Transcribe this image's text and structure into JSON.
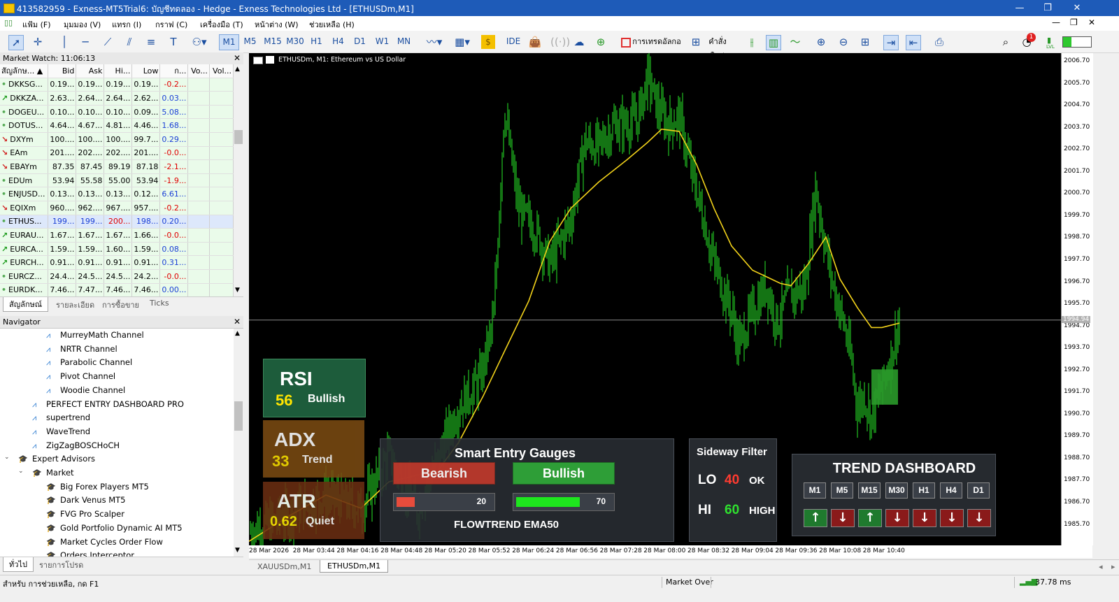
{
  "window": {
    "title": "413582959 - Exness-MT5Trial6: บัญชีทดลอง - Hedge - Exness Technologies Ltd - [ETHUSDm,M1]",
    "controls": [
      "—",
      "❐",
      "✕"
    ]
  },
  "menu": [
    "แฟ้ม (F)",
    "มุมมอง (V)",
    "แทรก (I)",
    "กราฟ (C)",
    "เครื่องมือ (T)",
    "หน้าต่าง (W)",
    "ช่วยเหลือ (H)"
  ],
  "toolbar": {
    "timeframes": [
      "M1",
      "M5",
      "M15",
      "M30",
      "H1",
      "H4",
      "D1",
      "W1",
      "MN"
    ],
    "active_timeframe": "M1",
    "ide_label": "IDE",
    "algo_label": "การเทรดอัลกอ",
    "new_order_label": "คำสั่งใหม่",
    "notification_count": "1",
    "signal_label": "LVL"
  },
  "market_watch": {
    "title": "Market Watch: 11:06:13",
    "columns": [
      "สัญลักษ...",
      "Bid",
      "Ask",
      "Hi...",
      "Low",
      "ก...",
      "Vo...",
      "Vol..."
    ],
    "rows": [
      {
        "sym": "DKKSG...",
        "arrow": "•",
        "bid": "0.19...",
        "ask": "0.19...",
        "hi": "0.19...",
        "low": "0.19...",
        "chg": "-0.2...",
        "chgcolor": "#e00000"
      },
      {
        "sym": "DKKZA...",
        "arrow": "↗",
        "bid": "2.63...",
        "ask": "2.64...",
        "hi": "2.64...",
        "low": "2.62...",
        "chg": "0.03...",
        "chgcolor": "#1a3fd6"
      },
      {
        "sym": "DOGEU...",
        "arrow": "•",
        "bid": "0.10...",
        "ask": "0.10...",
        "hi": "0.10...",
        "low": "0.09...",
        "chg": "5.08...",
        "chgcolor": "#1a3fd6"
      },
      {
        "sym": "DOTUS...",
        "arrow": "•",
        "bid": "4.64...",
        "ask": "4.67...",
        "hi": "4.81...",
        "low": "4.46...",
        "chg": "1.68...",
        "chgcolor": "#1a3fd6"
      },
      {
        "sym": "DXYm",
        "arrow": "↘",
        "bid": "100....",
        "ask": "100....",
        "hi": "100....",
        "low": "99.7...",
        "chg": "0.29...",
        "chgcolor": "#1a3fd6"
      },
      {
        "sym": "EAm",
        "arrow": "↘",
        "bid": "201....",
        "ask": "202....",
        "hi": "202....",
        "low": "201....",
        "chg": "-0.0...",
        "chgcolor": "#e00000"
      },
      {
        "sym": "EBAYm",
        "arrow": "↘",
        "bid": "87.35",
        "ask": "87.45",
        "hi": "89.19",
        "low": "87.18",
        "chg": "-2.1...",
        "chgcolor": "#e00000"
      },
      {
        "sym": "EDUm",
        "arrow": "•",
        "bid": "53.94",
        "ask": "55.58",
        "hi": "55.00",
        "low": "53.94",
        "chg": "-1.9...",
        "chgcolor": "#e00000"
      },
      {
        "sym": "ENJUSD...",
        "arrow": "•",
        "bid": "0.13...",
        "ask": "0.13...",
        "hi": "0.13...",
        "low": "0.12...",
        "chg": "6.61...",
        "chgcolor": "#1a3fd6"
      },
      {
        "sym": "EQIXm",
        "arrow": "↘",
        "bid": "960....",
        "ask": "962....",
        "hi": "967....",
        "low": "957....",
        "chg": "-0.2...",
        "chgcolor": "#e00000"
      },
      {
        "sym": "ETHUS...",
        "arrow": "•",
        "bid": "199...",
        "ask": "199...",
        "hi": "200...",
        "low": "198...",
        "chg": "0.20...",
        "chgcolor": "#1a3fd6",
        "selected": true
      },
      {
        "sym": "EURAU...",
        "arrow": "↗",
        "bid": "1.67...",
        "ask": "1.67...",
        "hi": "1.67...",
        "low": "1.66...",
        "chg": "-0.0...",
        "chgcolor": "#e00000"
      },
      {
        "sym": "EURCA...",
        "arrow": "↗",
        "bid": "1.59...",
        "ask": "1.59...",
        "hi": "1.60...",
        "low": "1.59...",
        "chg": "0.08...",
        "chgcolor": "#1a3fd6"
      },
      {
        "sym": "EURCH...",
        "arrow": "↗",
        "bid": "0.91...",
        "ask": "0.91...",
        "hi": "0.91...",
        "low": "0.91...",
        "chg": "0.31...",
        "chgcolor": "#1a3fd6"
      },
      {
        "sym": "EURCZ...",
        "arrow": "•",
        "bid": "24.4...",
        "ask": "24.5...",
        "hi": "24.5...",
        "low": "24.2...",
        "chg": "-0.0...",
        "chgcolor": "#e00000"
      },
      {
        "sym": "EURDK...",
        "arrow": "•",
        "bid": "7.46...",
        "ask": "7.47...",
        "hi": "7.46...",
        "low": "7.46...",
        "chg": "0.00...",
        "chgcolor": "#1a3fd6"
      }
    ],
    "tabs": [
      "สัญลักษณ์",
      "รายละเอียด",
      "การซื้อขาย",
      "Ticks"
    ]
  },
  "navigator": {
    "title": "Navigator",
    "items": [
      {
        "label": "MurreyMath Channel",
        "indent": 3
      },
      {
        "label": "NRTR Channel",
        "indent": 3
      },
      {
        "label": "Parabolic Channel",
        "indent": 3
      },
      {
        "label": "Pivot Channel",
        "indent": 3
      },
      {
        "label": "Woodie Channel",
        "indent": 3
      },
      {
        "label": "PERFECT ENTRY DASHBOARD PRO",
        "indent": 2
      },
      {
        "label": "supertrend",
        "indent": 2
      },
      {
        "label": "WaveTrend",
        "indent": 2
      },
      {
        "label": "ZigZagBOSCHoCH",
        "indent": 2
      },
      {
        "label": "Expert Advisors",
        "indent": 1
      },
      {
        "label": "Market",
        "indent": 2
      },
      {
        "label": "Big Forex Players MT5",
        "indent": 3
      },
      {
        "label": "Dark Venus MT5",
        "indent": 3
      },
      {
        "label": "FVG Pro Scalper",
        "indent": 3
      },
      {
        "label": "Gold Portfolio Dynamic AI MT5",
        "indent": 3
      },
      {
        "label": "Market Cycles Order Flow",
        "indent": 3
      },
      {
        "label": "Orders Interceptor",
        "indent": 3
      }
    ],
    "tabs": [
      "ทั่วไป",
      "รายการโปรด"
    ]
  },
  "chart": {
    "header": "ETHUSDm, M1:  Ethereum vs US Dollar",
    "price_labels": [
      "2006.70",
      "2005.70",
      "2004.70",
      "2003.70",
      "2002.70",
      "2001.70",
      "2000.70",
      "1999.70",
      "1998.70",
      "1997.70",
      "1996.70",
      "1995.70",
      "1994.70",
      "1993.70",
      "1992.70",
      "1991.70",
      "1990.70",
      "1989.70",
      "1988.70",
      "1987.70",
      "1986.70",
      "1985.70"
    ],
    "current_price": "1994.94",
    "time_labels": [
      "28 Mar 2026",
      "28 Mar 03:44",
      "28 Mar 04:16",
      "28 Mar 04:48",
      "28 Mar 05:20",
      "28 Mar 05:52",
      "28 Mar 06:24",
      "28 Mar 06:56",
      "28 Mar 07:28",
      "28 Mar 08:00",
      "28 Mar 08:32",
      "28 Mar 09:04",
      "28 Mar 09:36",
      "28 Mar 10:08",
      "28 Mar 10:40"
    ],
    "candle_color": "#22c322",
    "ema_color": "#f2d21a"
  },
  "overlays": {
    "rsi": {
      "name": "RSI",
      "value": "56",
      "state": "Bullish",
      "bg": "#1d5c3b"
    },
    "adx": {
      "name": "ADX",
      "value": "33",
      "state": "Trend",
      "bg": "#7a4a12"
    },
    "atr": {
      "name": "ATR",
      "value": "0.62",
      "state": "Quiet",
      "bg": "#6a2e12"
    },
    "gauges": {
      "title": "Smart Entry Gauges",
      "bearish_label": "Bearish",
      "bullish_label": "Bullish",
      "bear_value": "20",
      "bull_value": "70",
      "bear_fill": 0.2,
      "bull_fill": 0.7,
      "footer": "FLOWTREND EMA50"
    },
    "sideway": {
      "title": "Sideway Filter",
      "lo_label": "LO",
      "lo_value": "40",
      "lo_state": "OK",
      "hi_label": "HI",
      "hi_value": "60",
      "hi_state": "HIGH"
    },
    "trend": {
      "title": "TREND DASHBOARD",
      "timeframes": [
        "M1",
        "M5",
        "M15",
        "M30",
        "H1",
        "H4",
        "D1"
      ],
      "directions": [
        "up",
        "down",
        "up",
        "down",
        "down",
        "down",
        "down"
      ]
    }
  },
  "chart_tabs": [
    "XAUUSDm,M1",
    "ETHUSDm,M1"
  ],
  "active_chart_tab": "ETHUSDm,M1",
  "status": {
    "help": "สำหรับ การช่วยเหลือ, กด F1",
    "mode": "Market Over",
    "ping": "37.78 ms"
  }
}
